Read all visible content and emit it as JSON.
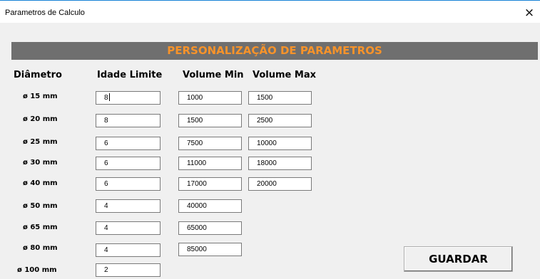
{
  "window": {
    "title": "Parametros de Calculo",
    "close_glyph": "×"
  },
  "banner": {
    "text": "PERSONALIZAÇÃO DE PARAMETROS",
    "bg_color": "#6f6f6f",
    "text_color": "#f7932a"
  },
  "headers": {
    "diametro": "Diâmetro",
    "idade": "Idade Limite",
    "vmin": "Volume Min",
    "vmax": "Volume Max"
  },
  "rows": [
    {
      "label": "ø 15 mm",
      "idade": "8",
      "vmin": "1000",
      "vmax": "1500"
    },
    {
      "label": "ø 20 mm",
      "idade": "8",
      "vmin": "1500",
      "vmax": "2500"
    },
    {
      "label": "ø 25 mm",
      "idade": "6",
      "vmin": "7500",
      "vmax": "10000"
    },
    {
      "label": "ø 30 mm",
      "idade": "6",
      "vmin": "11000",
      "vmax": "18000"
    },
    {
      "label": "ø 40 mm",
      "idade": "6",
      "vmin": "17000",
      "vmax": "20000"
    },
    {
      "label": "ø 50  mm",
      "idade": "4",
      "vmin": "40000"
    },
    {
      "label": "ø 65  mm",
      "idade": "4",
      "vmin": "65000"
    },
    {
      "label": "ø 80  mm",
      "idade": "4",
      "vmin": "85000"
    },
    {
      "label": "ø 100 mm",
      "idade": "2"
    }
  ],
  "buttons": {
    "save": "GUARDAR"
  }
}
